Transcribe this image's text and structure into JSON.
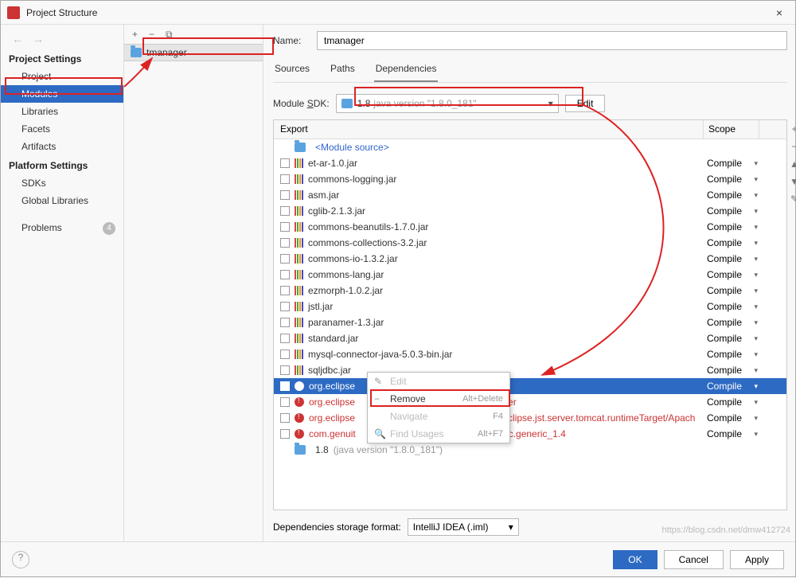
{
  "window": {
    "title": "Project Structure",
    "close": "×"
  },
  "left": {
    "nav_back": "←",
    "nav_fwd": "→",
    "section1": "Project Settings",
    "items1": [
      "Project",
      "Modules",
      "Libraries",
      "Facets",
      "Artifacts"
    ],
    "selected1": 1,
    "section2": "Platform Settings",
    "items2": [
      "SDKs",
      "Global Libraries"
    ],
    "problems": "Problems",
    "problems_count": "4"
  },
  "middle": {
    "toolbar": {
      "add": "+",
      "remove": "−",
      "copy": "⧉"
    },
    "tree_item": "tmanager"
  },
  "form": {
    "name_label": "Name:",
    "name_key_underlined": "N",
    "name_value": "tmanager"
  },
  "tabs": {
    "sources": "Sources",
    "paths": "Paths",
    "deps": "Dependencies",
    "active": "deps"
  },
  "sdk": {
    "label": "Module SDK:",
    "underlined": "S",
    "combo_primary": "1.8",
    "combo_secondary": "java version \"1.8.0_181\"",
    "edit": "Edit"
  },
  "table": {
    "headers": {
      "export": "Export",
      "scope": "Scope"
    },
    "module_source": "<Module source>",
    "rows": [
      {
        "label": "et-ar-1.0.jar",
        "scope": "Compile"
      },
      {
        "label": "commons-logging.jar",
        "scope": "Compile"
      },
      {
        "label": "asm.jar",
        "scope": "Compile"
      },
      {
        "label": "cglib-2.1.3.jar",
        "scope": "Compile"
      },
      {
        "label": "commons-beanutils-1.7.0.jar",
        "scope": "Compile"
      },
      {
        "label": "commons-collections-3.2.jar",
        "scope": "Compile"
      },
      {
        "label": "commons-io-1.3.2.jar",
        "scope": "Compile"
      },
      {
        "label": "commons-lang.jar",
        "scope": "Compile"
      },
      {
        "label": "ezmorph-1.0.2.jar",
        "scope": "Compile"
      },
      {
        "label": "jstl.jar",
        "scope": "Compile"
      },
      {
        "label": "paranamer-1.3.jar",
        "scope": "Compile"
      },
      {
        "label": "standard.jar",
        "scope": "Compile"
      },
      {
        "label": "mysql-connector-java-5.0.3-bin.jar",
        "scope": "Compile"
      },
      {
        "label": "sqljdbc.jar",
        "scope": "Compile"
      }
    ],
    "selected": {
      "label": "org.eclipse",
      "scope": "Compile"
    },
    "err_rows": [
      {
        "label": "org.eclipse",
        "trail": "er",
        "scope": "Compile"
      },
      {
        "label": "org.eclipse",
        "trail": "clipse.jst.server.tomcat.runtimeTarget/Apach",
        "scope": "Compile"
      },
      {
        "label": "com.genuit",
        "trail": "c.generic_1.4",
        "scope": "Compile"
      }
    ],
    "sdkline": {
      "primary": "1.8",
      "secondary": "(java version \"1.8.0_181\")"
    }
  },
  "context_menu": {
    "edit": "Edit",
    "remove": "Remove",
    "remove_sc": "Alt+Delete",
    "navigate": "Navigate",
    "navigate_sc": "F4",
    "find": "Find Usages",
    "find_sc": "Alt+F7"
  },
  "storage": {
    "label": "Dependencies storage format:",
    "value": "IntelliJ IDEA (.iml)"
  },
  "footer": {
    "help": "?",
    "ok": "OK",
    "cancel": "Cancel",
    "apply": "Apply"
  },
  "sidetools": {
    "plus": "+",
    "minus": "−",
    "up": "▲",
    "down": "▼",
    "edit": "✎"
  },
  "watermark": "https://blog.csdn.net/dmw412724"
}
